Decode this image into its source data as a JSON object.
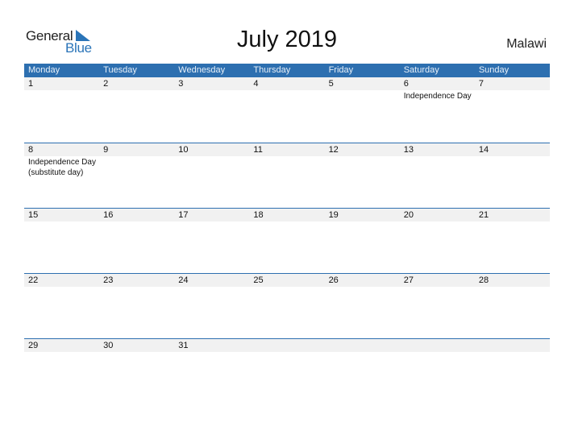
{
  "logo": {
    "general": "General",
    "blue": "Blue",
    "accent": "#2a74b8"
  },
  "title": "July 2019",
  "country": "Malawi",
  "colors": {
    "header_bg": "#2d6fb0",
    "date_band": "#f1f1f1"
  },
  "weekdays": [
    "Monday",
    "Tuesday",
    "Wednesday",
    "Thursday",
    "Friday",
    "Saturday",
    "Sunday"
  ],
  "weeks": [
    {
      "days": [
        "1",
        "2",
        "3",
        "4",
        "5",
        "6",
        "7"
      ],
      "events": [
        "",
        "",
        "",
        "",
        "",
        "Independence Day",
        ""
      ]
    },
    {
      "days": [
        "8",
        "9",
        "10",
        "11",
        "12",
        "13",
        "14"
      ],
      "events": [
        "Independence Day\n(substitute day)",
        "",
        "",
        "",
        "",
        "",
        ""
      ]
    },
    {
      "days": [
        "15",
        "16",
        "17",
        "18",
        "19",
        "20",
        "21"
      ],
      "events": [
        "",
        "",
        "",
        "",
        "",
        "",
        ""
      ]
    },
    {
      "days": [
        "22",
        "23",
        "24",
        "25",
        "26",
        "27",
        "28"
      ],
      "events": [
        "",
        "",
        "",
        "",
        "",
        "",
        ""
      ]
    },
    {
      "days": [
        "29",
        "30",
        "31",
        "",
        "",
        "",
        ""
      ],
      "events": [
        "",
        "",
        "",
        "",
        "",
        "",
        ""
      ]
    }
  ]
}
